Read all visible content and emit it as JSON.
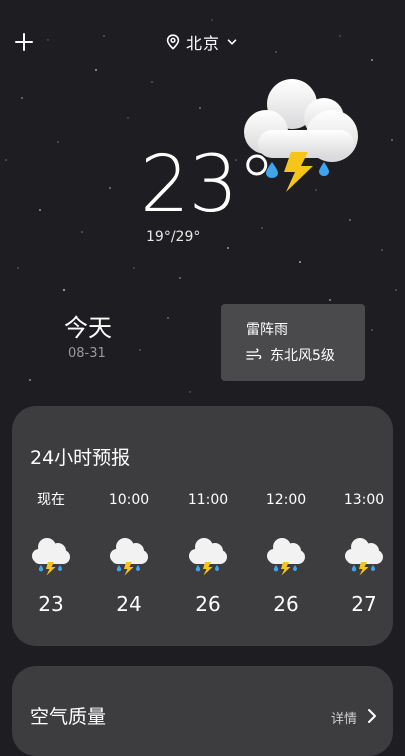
{
  "header": {
    "add_icon": "plus-icon",
    "location_icon": "location-pin-icon",
    "city": "北京",
    "dropdown_icon": "chevron-down-icon"
  },
  "current": {
    "temperature": "23°",
    "range": "19°/29°",
    "illustration": "thunderstorm-cloud-icon"
  },
  "today": {
    "label": "今天",
    "date": "08-31",
    "condition": "雷阵雨",
    "wind_icon": "wind-icon",
    "wind": "东北风5级"
  },
  "forecast": {
    "title": "24小时预报",
    "hours": [
      {
        "time": "现在",
        "temp": "23",
        "icon": "thunderstorm-icon"
      },
      {
        "time": "10:00",
        "temp": "24",
        "icon": "thunderstorm-icon"
      },
      {
        "time": "11:00",
        "temp": "26",
        "icon": "thunderstorm-icon"
      },
      {
        "time": "12:00",
        "temp": "26",
        "icon": "thunderstorm-icon"
      },
      {
        "time": "13:00",
        "temp": "27",
        "icon": "thunderstorm-icon"
      }
    ]
  },
  "air_quality": {
    "title": "空气质量",
    "detail": "详情",
    "chevron_icon": "chevron-right-icon"
  },
  "colors": {
    "background": "#1e1e22",
    "card": "#3d3d40",
    "condition_card": "#4a4a4d",
    "bolt": "#f5c518",
    "rain_drop": "#3fa4f0"
  }
}
